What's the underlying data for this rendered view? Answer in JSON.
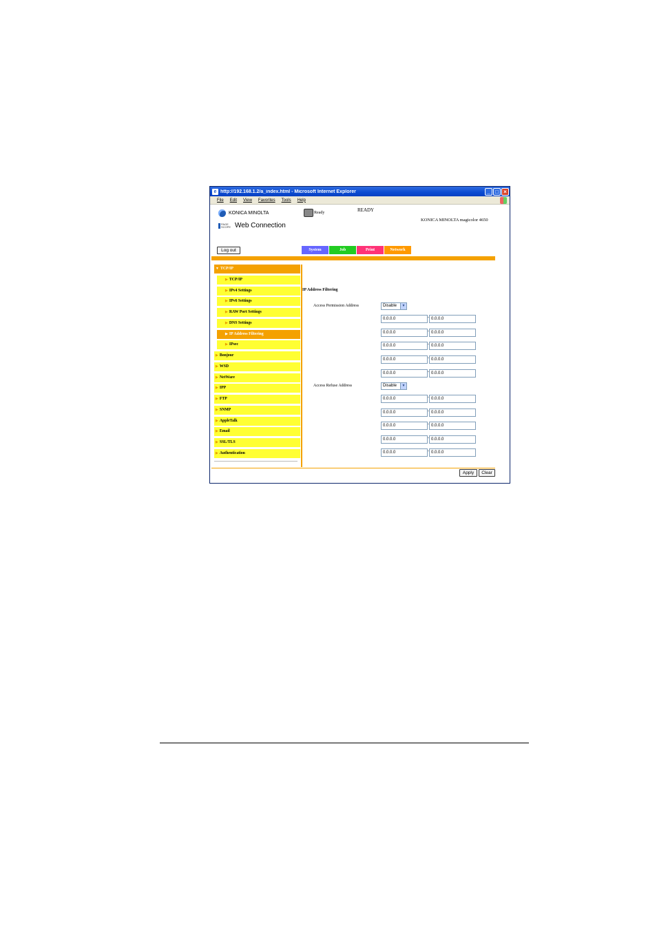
{
  "browser": {
    "title": "http://192.168.1.2/a_index.html - Microsoft Internet Explorer",
    "menu": [
      "File",
      "Edit",
      "View",
      "Favorites",
      "Tools",
      "Help"
    ]
  },
  "header": {
    "brand": "KONICA MINOLTA",
    "pagescope": "PAGE SCOPE",
    "web_connection": "Web Connection",
    "status_small": "Ready",
    "status_big": "READY",
    "model": "KONICA MINOLTA magicolor 4650",
    "logout": "Log out"
  },
  "tabs": [
    {
      "label": "System",
      "color": "#6666ff"
    },
    {
      "label": "Job",
      "color": "#22cc22"
    },
    {
      "label": "Print",
      "color": "#ff3377"
    },
    {
      "label": "Network",
      "color": "#ff9900"
    }
  ],
  "sidebar": {
    "items": [
      {
        "label": "TCP/IP",
        "level": 0,
        "active": true,
        "open": true
      },
      {
        "label": "TCP/IP",
        "level": 1
      },
      {
        "label": "IPv4 Settings",
        "level": 1
      },
      {
        "label": "IPv6 Settings",
        "level": 1
      },
      {
        "label": "RAW Port Settings",
        "level": 1
      },
      {
        "label": "DNS Settings",
        "level": 1
      },
      {
        "label": "IP Address Filtering",
        "level": 1,
        "active": true
      },
      {
        "label": "IPsec",
        "level": 1
      },
      {
        "label": "Bonjour",
        "level": 0
      },
      {
        "label": "WSD",
        "level": 0
      },
      {
        "label": "NetWare",
        "level": 0
      },
      {
        "label": "IPP",
        "level": 0
      },
      {
        "label": "FTP",
        "level": 0
      },
      {
        "label": "SNMP",
        "level": 0
      },
      {
        "label": "AppleTalk",
        "level": 0
      },
      {
        "label": "Email",
        "level": 0
      },
      {
        "label": "SSL/TLS",
        "level": 0
      },
      {
        "label": "Authentication",
        "level": 0
      }
    ]
  },
  "main": {
    "title": "IP Address Filtering",
    "permission": {
      "label": "Access Permission Address",
      "select": "Disable",
      "ranges": [
        [
          "0.0.0.0",
          "0.0.0.0"
        ],
        [
          "0.0.0.0",
          "0.0.0.0"
        ],
        [
          "0.0.0.0",
          "0.0.0.0"
        ],
        [
          "0.0.0.0",
          "0.0.0.0"
        ],
        [
          "0.0.0.0",
          "0.0.0.0"
        ]
      ]
    },
    "refuse": {
      "label": "Access Refuse Address",
      "select": "Disable",
      "ranges": [
        [
          "0.0.0.0",
          "0.0.0.0"
        ],
        [
          "0.0.0.0",
          "0.0.0.0"
        ],
        [
          "0.0.0.0",
          "0.0.0.0"
        ],
        [
          "0.0.0.0",
          "0.0.0.0"
        ],
        [
          "0.0.0.0",
          "0.0.0.0"
        ]
      ]
    },
    "range_separator": "-",
    "apply": "Apply",
    "clear": "Clear"
  }
}
